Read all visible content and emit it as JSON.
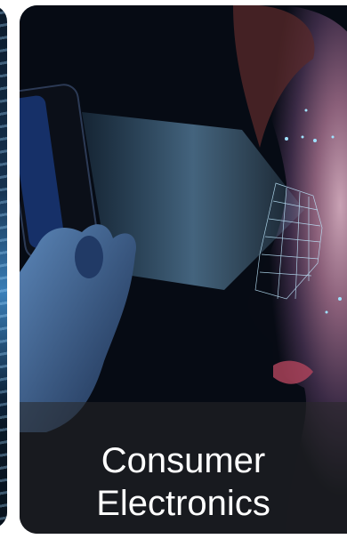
{
  "carousel": {
    "current_card": {
      "caption_line1": "Consumer",
      "caption_line2": "Electronics",
      "image_alt": "woman-face-scan-image"
    }
  },
  "colors": {
    "caption_text": "#ffffff",
    "scan_glow": "#7ad2ff",
    "background": "#ffffff"
  }
}
